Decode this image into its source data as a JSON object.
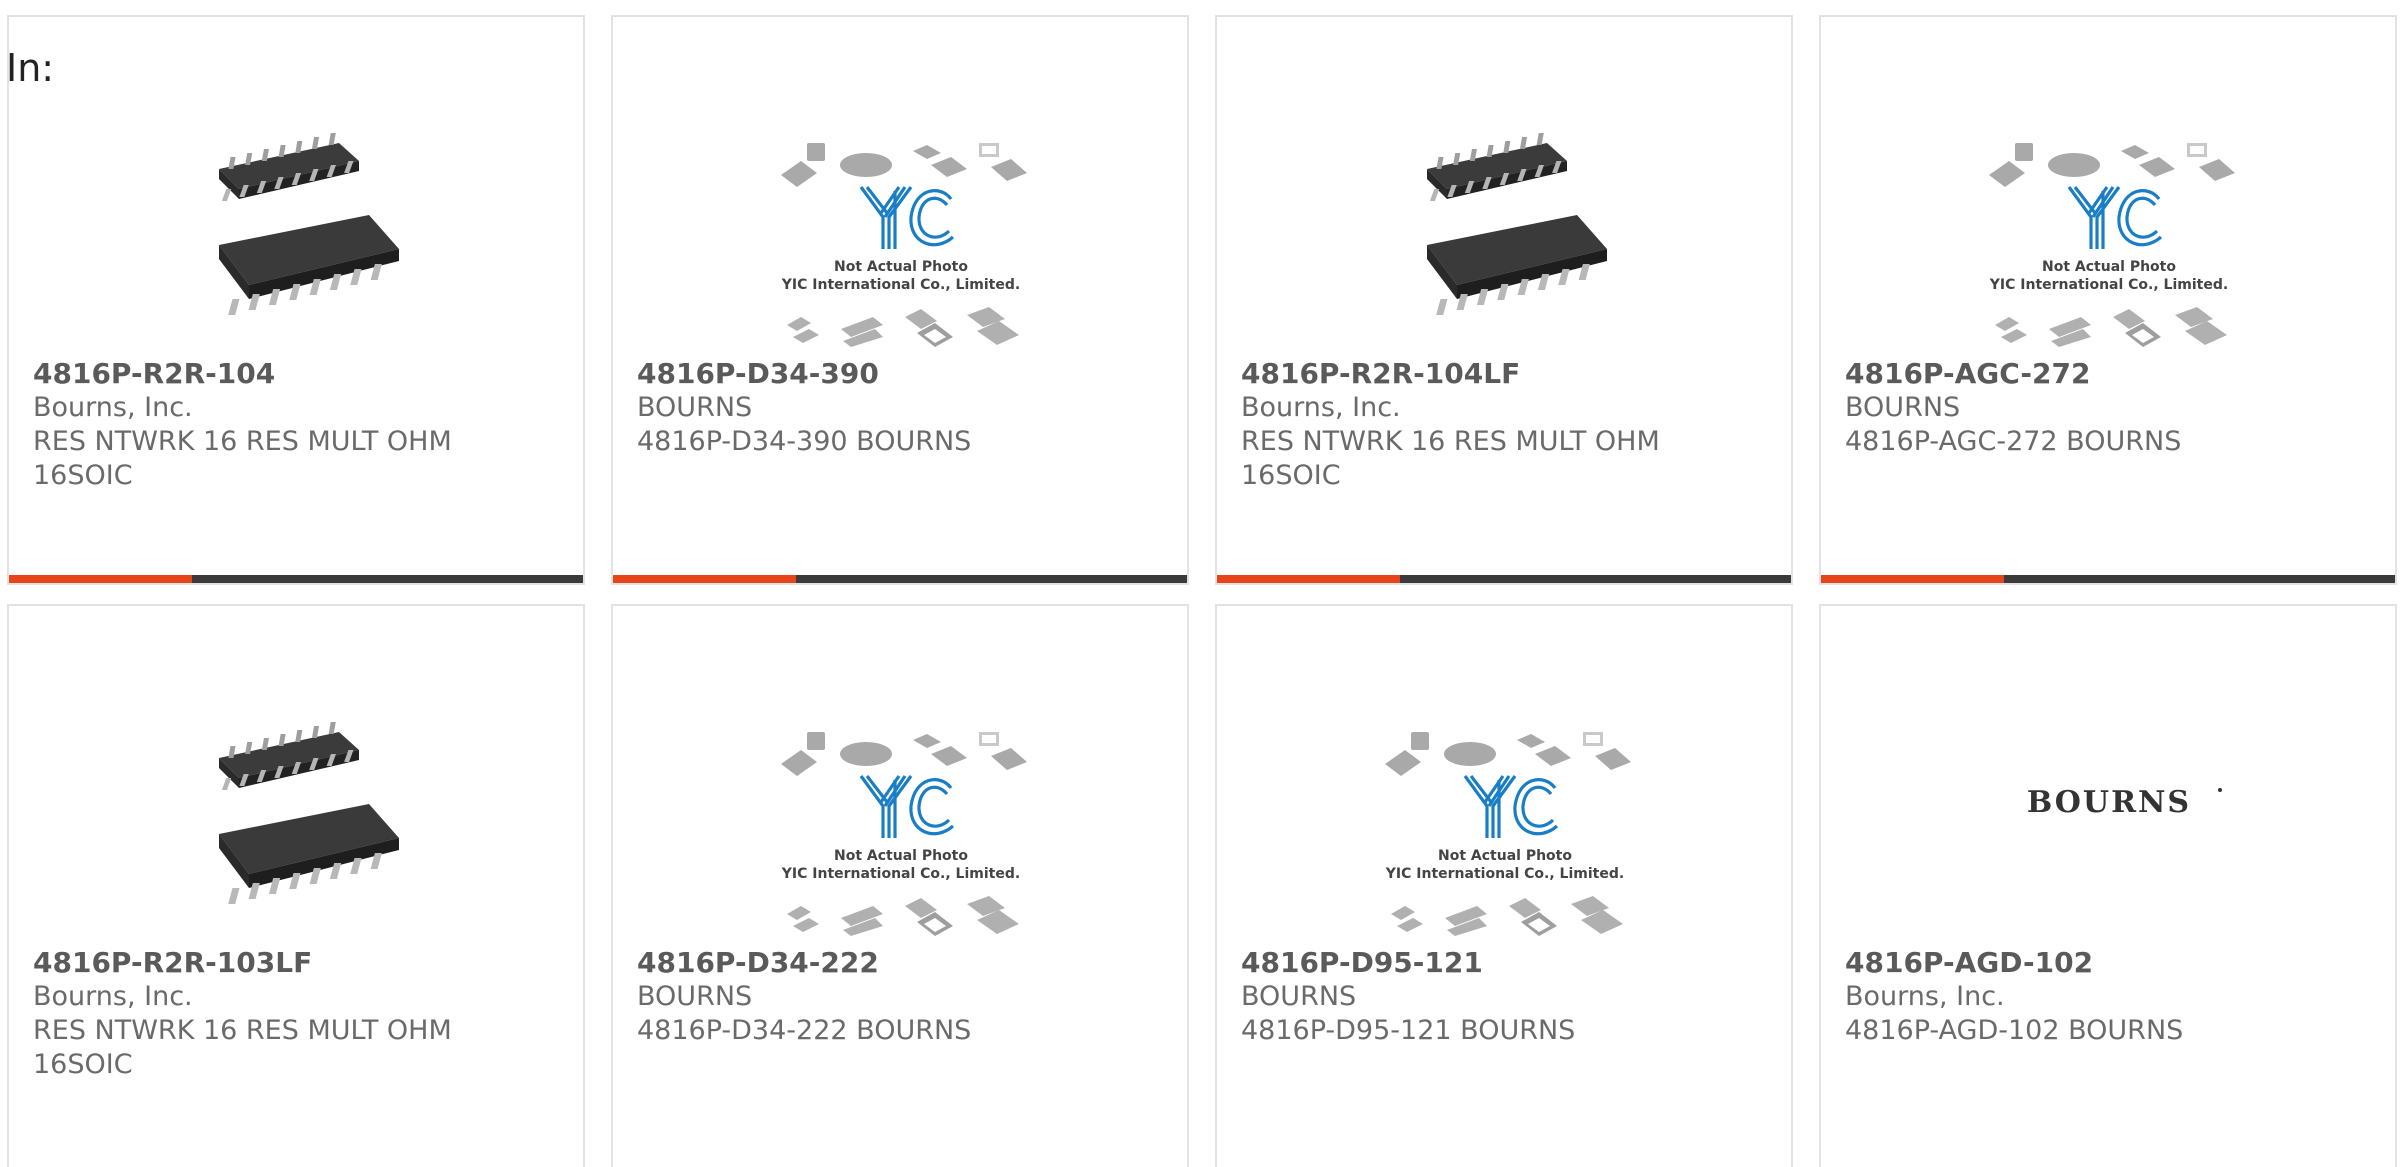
{
  "in_label": "In:",
  "accent_color": "#e8441a",
  "bar_color": "#3a3a3a",
  "cards": [
    {
      "part": "4816P-R2R-104",
      "manufacturer": "Bourns, Inc.",
      "description": "RES NTWRK 16 RES MULT OHM 16SOIC",
      "image": "soic-chip-photo"
    },
    {
      "part": "4816P-D34-390",
      "manufacturer": "BOURNS",
      "description": "4816P-D34-390 BOURNS",
      "image": "yic-placeholder",
      "placeholder_line1": "Not Actual Photo",
      "placeholder_line2": "YIC International Co., Limited."
    },
    {
      "part": "4816P-R2R-104LF",
      "manufacturer": "Bourns, Inc.",
      "description": "RES NTWRK 16 RES MULT OHM 16SOIC",
      "image": "soic-chip-photo"
    },
    {
      "part": "4816P-AGC-272",
      "manufacturer": "BOURNS",
      "description": "4816P-AGC-272 BOURNS",
      "image": "yic-placeholder",
      "placeholder_line1": "Not Actual Photo",
      "placeholder_line2": "YIC International Co., Limited."
    },
    {
      "part": "4816P-R2R-103LF",
      "manufacturer": "Bourns, Inc.",
      "description": "RES NTWRK 16 RES MULT OHM 16SOIC",
      "image": "soic-chip-photo"
    },
    {
      "part": "4816P-D34-222",
      "manufacturer": "BOURNS",
      "description": "4816P-D34-222 BOURNS",
      "image": "yic-placeholder",
      "placeholder_line1": "Not Actual Photo",
      "placeholder_line2": "YIC International Co., Limited."
    },
    {
      "part": "4816P-D95-121",
      "manufacturer": "BOURNS",
      "description": "4816P-D95-121 BOURNS",
      "image": "yic-placeholder",
      "placeholder_line1": "Not Actual Photo",
      "placeholder_line2": "YIC International Co., Limited."
    },
    {
      "part": "4816P-AGD-102",
      "manufacturer": "Bourns, Inc.",
      "description": "4816P-AGD-102 BOURNS",
      "image": "bourns-logo",
      "logo_text": "BOURNS"
    }
  ]
}
